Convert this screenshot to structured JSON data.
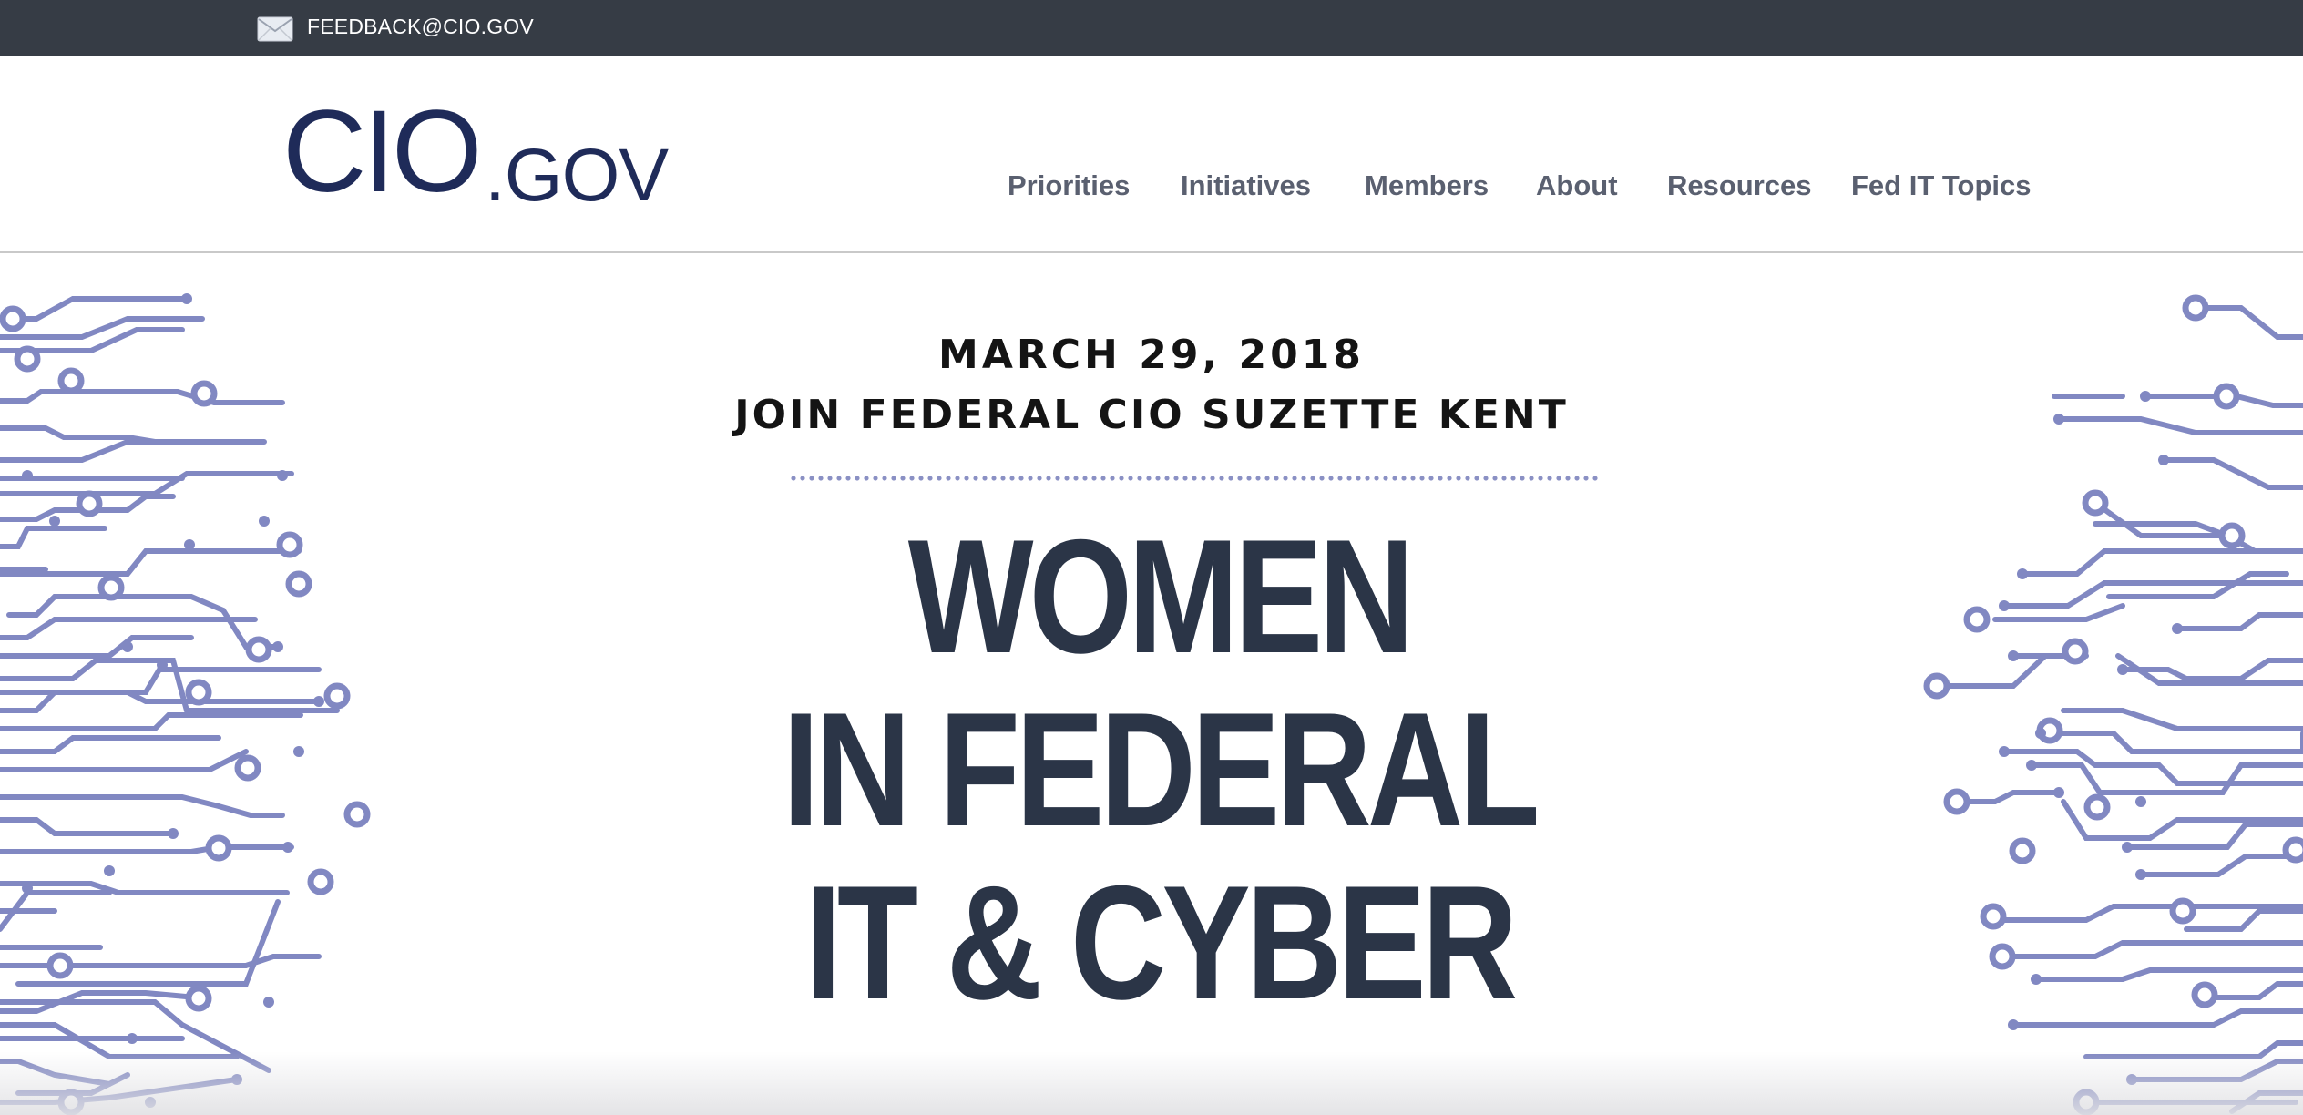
{
  "topbar": {
    "icon": "mail-icon",
    "email": "FEEDBACK@CIO.GOV"
  },
  "header": {
    "logo": {
      "main": "CIO",
      "suffix": ".GOV",
      "color": "#1f2b59"
    },
    "nav": [
      {
        "label": "Priorities"
      },
      {
        "label": "Initiatives"
      },
      {
        "label": "Members"
      },
      {
        "label": "About"
      },
      {
        "label": "Resources"
      },
      {
        "label": "Fed IT Topics"
      }
    ]
  },
  "hero": {
    "date": "MARCH 29, 2018",
    "subtitle": "JOIN FEDERAL CIO SUZETTE KENT",
    "headline": [
      "WOMEN",
      "IN FEDERAL",
      "IT & CYBER"
    ],
    "accent_color": "#8a90c4",
    "headline_color": "#2b3547"
  },
  "colors": {
    "topbar_bg": "#363c45",
    "nav_text": "#5a6070"
  }
}
